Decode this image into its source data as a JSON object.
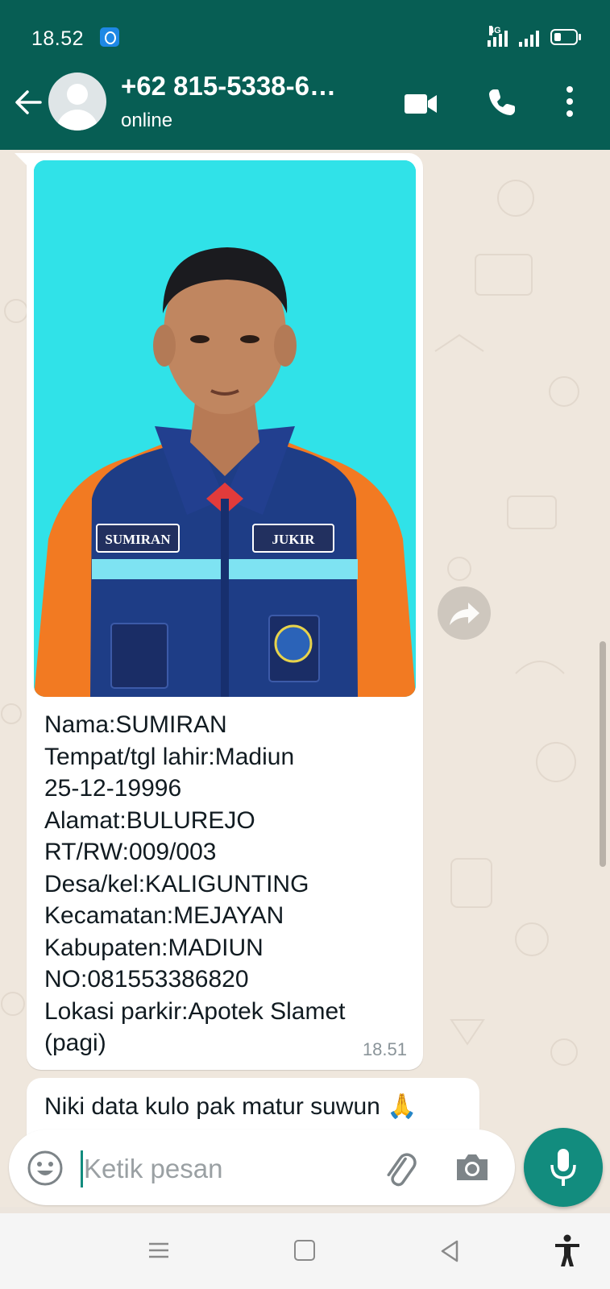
{
  "status_bar": {
    "time": "18.52",
    "network_label": "4G",
    "icons": [
      "app-notification-icon",
      "signal-4g-icon",
      "signal-icon",
      "battery-icon"
    ]
  },
  "header": {
    "contact_name": "+62 815-5338-6…",
    "status": "online",
    "icons": [
      "back-arrow-icon",
      "avatar",
      "video-call-icon",
      "voice-call-icon",
      "more-options-icon"
    ],
    "colors": {
      "header_bg": "#075e54",
      "accent": "#128c7e"
    }
  },
  "messages": [
    {
      "type": "image",
      "image_alt": "Foto",
      "caption_lines": [
        "Nama:SUMIRAN",
        "Tempat/tgl lahir:Madiun",
        "25-12-19996",
        "Alamat:BULUREJO",
        "RT/RW:009/003",
        "Desa/kel:KALIGUNTING",
        "Kecamatan:MEJAYAN",
        "Kabupaten:MADIUN",
        "NO:081553386820",
        "Lokasi parkir:Apotek Slamet",
        "(pagi)"
      ],
      "time": "18.51",
      "photo_badges": {
        "left": "SUMIRAN",
        "right": "JUKIR"
      }
    },
    {
      "type": "text",
      "text": "Niki data kulo pak matur suwun 🙏"
    }
  ],
  "composer": {
    "placeholder": "Ketik pesan",
    "icons": [
      "emoji-icon",
      "attach-icon",
      "camera-icon",
      "mic-icon"
    ]
  },
  "nav_bar": {
    "icons": [
      "menu-icon",
      "home-icon",
      "back-triangle-icon",
      "accessibility-icon"
    ]
  }
}
